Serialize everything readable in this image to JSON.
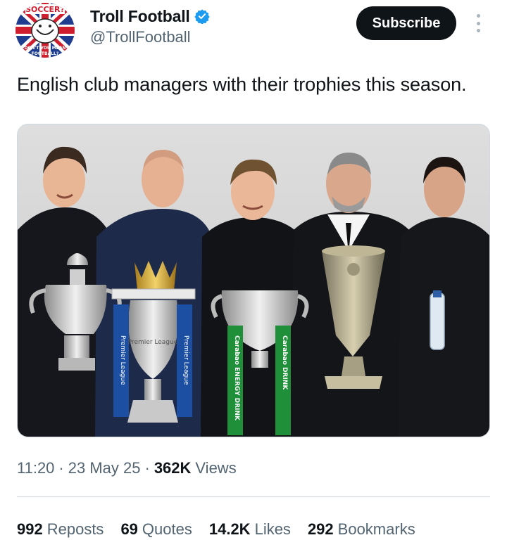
{
  "author": {
    "display_name": "Troll Football",
    "handle": "@TrollFootball",
    "avatar_texts": [
      "SOCCER?",
      "DON'T YOU MEAN",
      "FOOTBALL?"
    ]
  },
  "actions": {
    "subscribe_label": "Subscribe"
  },
  "tweet": {
    "text": "English club managers with their trophies this season."
  },
  "media": {
    "ribbon_texts": [
      "Carabao ENERGY DRINK",
      "Carabao DRINK",
      "Premier League",
      "Premier League"
    ],
    "trophy_label": "Premier League"
  },
  "meta": {
    "time": "11:20",
    "date": "23 May 25",
    "views_count": "362K",
    "views_label": "Views",
    "separator": "·"
  },
  "stats": [
    {
      "count": "992",
      "label": "Reposts"
    },
    {
      "count": "69",
      "label": "Quotes"
    },
    {
      "count": "14.2K",
      "label": "Likes"
    },
    {
      "count": "292",
      "label": "Bookmarks"
    }
  ],
  "colors": {
    "text_primary": "#0f1419",
    "text_secondary": "#536471",
    "verified_blue": "#1d9bf0",
    "divider": "#cfd9de",
    "carabao_green": "#1f8f3a"
  },
  "icons": {
    "verified": "verified-badge-icon",
    "more": "more-options-icon"
  }
}
